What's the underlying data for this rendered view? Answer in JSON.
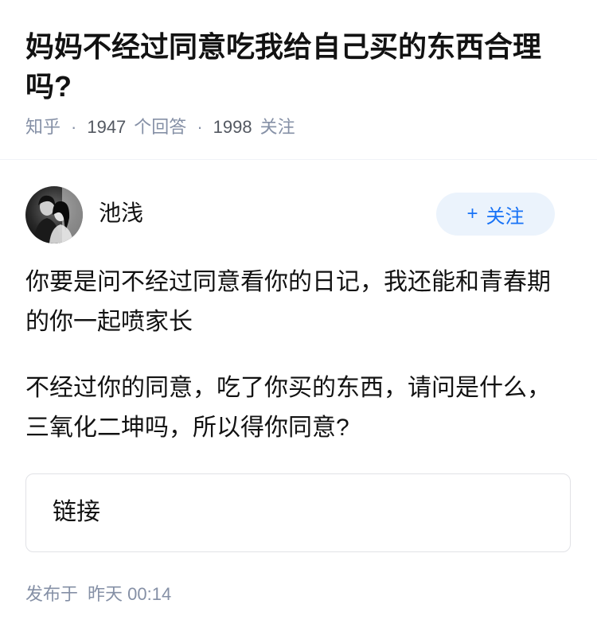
{
  "question": {
    "title": "妈妈不经过同意吃我给自己买的东西合理吗?"
  },
  "meta": {
    "source": "知乎",
    "separator": "·",
    "answer_count": "1947",
    "answer_label": "个回答",
    "follower_count": "1998",
    "follower_label": "关注"
  },
  "answer": {
    "author": {
      "name": "池浅",
      "avatar_icon": "avatar-photo"
    },
    "follow_button": {
      "icon_text": "+",
      "label": "关注"
    },
    "paragraphs": [
      "你要是问不经过同意看你的日记，我还能和青春期的你一起喷家长",
      "不经过你的同意，吃了你买的东西，请问是什么，三氧化二坤吗，所以得你同意?"
    ],
    "link_card": {
      "label": "链接"
    },
    "published": {
      "label": "发布于",
      "time": "昨天 00:14"
    }
  },
  "colors": {
    "text_primary": "#121212",
    "text_secondary": "#8590A6",
    "meta_number": "#535861",
    "accent_blue": "#1772F6",
    "follow_button_bg": "#EBF3FC",
    "divider": "#F0F2F7",
    "card_border": "#E1E2E6"
  }
}
